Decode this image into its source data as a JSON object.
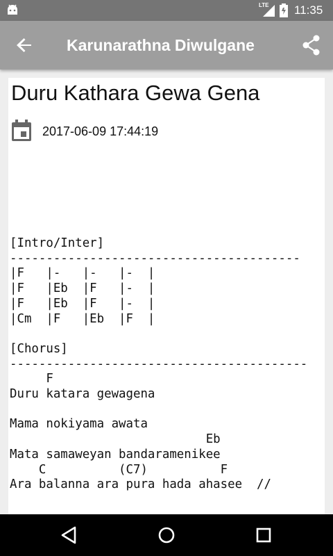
{
  "status_bar": {
    "network_label": "LTE",
    "time": "11:35"
  },
  "app_bar": {
    "title": "Karunarathna Diwulgane",
    "back_icon": "arrow-back-icon",
    "share_icon": "share-icon"
  },
  "song": {
    "title": "Duru Kathara Gewa Gena",
    "date": "2017-06-09 17:44:19",
    "lyrics_lines": [
      "[Intro/Inter]",
      "----------------------------------------",
      "|F   |-   |-   |-  |",
      "|F   |Eb  |F   |-  |",
      "|F   |Eb  |F   |-  |",
      "|Cm  |F   |Eb  |F  |",
      "",
      "[Chorus]",
      "-----------------------------------------",
      "     F",
      "Duru katara gewagena",
      "",
      "Mama nokiyama awata",
      "                           Eb",
      "Mata samaweyan bandaramenikee",
      "    C          (C7)          F",
      "Ara balanna ara pura hada ahasee  //"
    ]
  },
  "nav_bar": {
    "back_icon": "nav-back-icon",
    "home_icon": "nav-home-icon",
    "recents_icon": "nav-recents-icon"
  }
}
